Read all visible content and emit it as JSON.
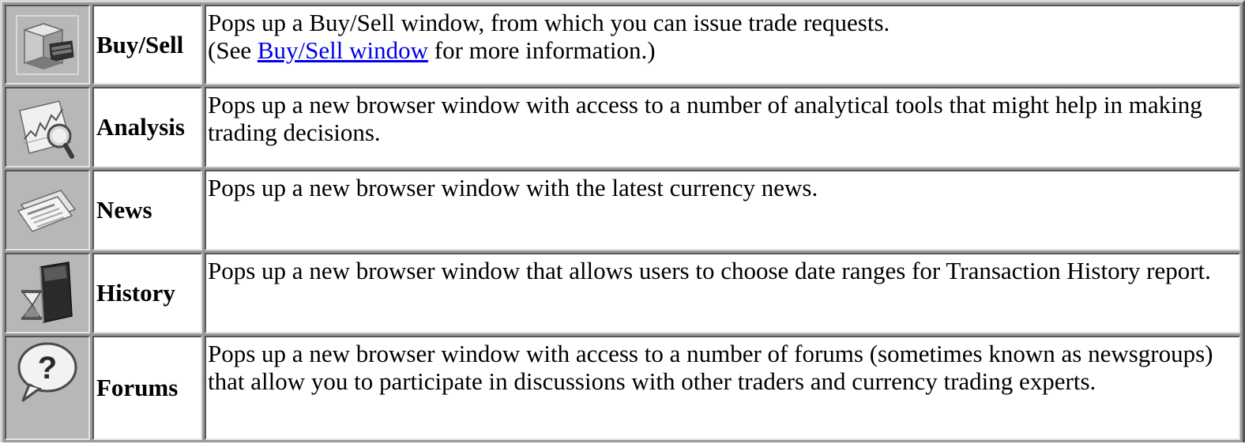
{
  "rows": [
    {
      "icon": "cash-register-icon",
      "label": "Buy/Sell",
      "line1": "Pops up a Buy/Sell window, from which you can issue trade requests.",
      "line2_prefix": "(See ",
      "link_text": "Buy/Sell window",
      "line2_suffix": " for more information.)"
    },
    {
      "icon": "chart-magnifier-icon",
      "label": "Analysis",
      "description": "Pops up a new browser window with access to a number of analytical tools that might help in making trading decisions."
    },
    {
      "icon": "newspaper-icon",
      "label": "News",
      "description": "Pops up a new browser window with the latest currency news."
    },
    {
      "icon": "hourglass-book-icon",
      "label": "History",
      "description": "Pops up a new browser window that allows users to choose date ranges for Transaction History report."
    },
    {
      "icon": "question-bubble-icon",
      "label": "Forums",
      "description": "Pops up a new browser window with access to a number of forums (sometimes known as newsgroups) that allow you to participate in discussions with other traders and currency trading experts."
    }
  ],
  "colors": {
    "link": "#0000ee",
    "icon_background": "#b7b7b7",
    "table_frame": "#9a9a9a"
  }
}
